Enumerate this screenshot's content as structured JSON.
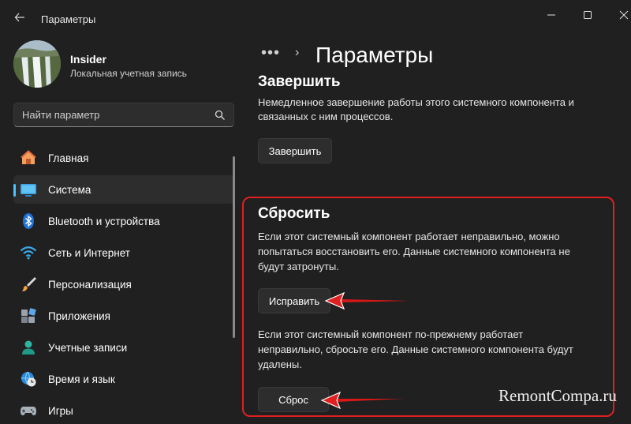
{
  "window": {
    "title": "Параметры",
    "controls": [
      "minimize",
      "maximize",
      "close"
    ]
  },
  "profile": {
    "name": "Insider",
    "account_type": "Локальная учетная запись"
  },
  "search": {
    "placeholder": "Найти параметр"
  },
  "nav": {
    "items": [
      {
        "label": "Главная",
        "icon": "home-icon",
        "active": false
      },
      {
        "label": "Система",
        "icon": "monitor-icon",
        "active": true
      },
      {
        "label": "Bluetooth и устройства",
        "icon": "bluetooth-icon",
        "active": false
      },
      {
        "label": "Сеть и Интернет",
        "icon": "wifi-icon",
        "active": false
      },
      {
        "label": "Персонализация",
        "icon": "brush-icon",
        "active": false
      },
      {
        "label": "Приложения",
        "icon": "apps-icon",
        "active": false
      },
      {
        "label": "Учетные записи",
        "icon": "person-icon",
        "active": false
      },
      {
        "label": "Время и язык",
        "icon": "globe-clock-icon",
        "active": false
      },
      {
        "label": "Игры",
        "icon": "gamepad-icon",
        "active": false
      }
    ]
  },
  "header": {
    "breadcrumb_overflow": "•••",
    "breadcrumb_separator": "›",
    "title": "Параметры"
  },
  "terminate": {
    "title": "Завершить",
    "description_line1": "Немедленное завершение работы этого системного компонента и",
    "description_line2": "связанных с ним процессов.",
    "button_label": "Завершить"
  },
  "reset": {
    "title": "Сбросить",
    "repair_text_line1": "Если этот системный компонент работает неправильно, можно",
    "repair_text_line2": "попытаться восстановить его. Данные системного компонента не",
    "repair_text_line3": "будут затронуты.",
    "repair_button": "Исправить",
    "reset_text_line1": "Если этот системный компонент по-прежнему работает",
    "reset_text_line2": "неправильно, сбросьте его. Данные системного компонента будут",
    "reset_text_line3": "удалены.",
    "reset_button": "Сброс"
  },
  "watermark": "RemontCompa.ru",
  "colors": {
    "background": "#202020",
    "accent": "#4cc2ff",
    "annotation_red": "#e02020"
  }
}
